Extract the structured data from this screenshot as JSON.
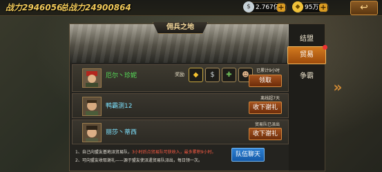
{
  "header": {
    "power_label": "战力2946056",
    "total_power_label": "总战力24900864",
    "silver": "2.767亿",
    "gold": "95万",
    "back_icon": "return-arrow-icon"
  },
  "panel": {
    "title": "佣兵之地",
    "rows": [
      {
        "name": "厄尔丶珍妮",
        "rewards_label": "奖励",
        "status": "已累计9小时",
        "button": "领取"
      },
      {
        "name": "鸭霸测12",
        "status": "离线超7天",
        "button": "收下谢礼"
      },
      {
        "name": "丽莎丶蒂西",
        "status": "贸易队已派出",
        "button": "收下谢礼"
      }
    ],
    "notes": [
      {
        "prefix": "1、自己向盟友基地派贸易队，",
        "highlight": "3小时后点贸易队可获收入，最多累积9小时。",
        "suffix": ""
      },
      {
        "prefix": "2、可向盟友收取谢礼——源于盟友使派遣贸易队派出，每日领一次。",
        "highlight": "",
        "suffix": ""
      }
    ],
    "team_button": "队伍聊天"
  },
  "sidebar": {
    "items": [
      "结盟",
      "贸易",
      "争霸"
    ],
    "active": "贸易"
  },
  "colors": {
    "accent": "#d27a1f",
    "name_green": "#57e35a",
    "name_cyan": "#7ee3ff",
    "highlight_red": "#ff5c44",
    "blue_button": "#2d7fd1"
  }
}
